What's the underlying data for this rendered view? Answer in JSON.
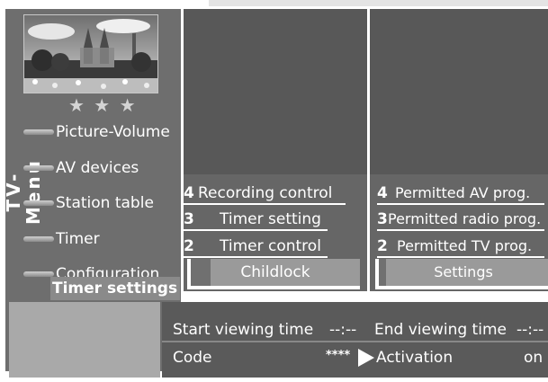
{
  "sidebar": {
    "title": "TV-Menu",
    "stars": "★ ★ ★",
    "items": [
      {
        "label": "Picture-Volume"
      },
      {
        "label": "AV devices"
      },
      {
        "label": "Station table"
      },
      {
        "label": "Timer"
      },
      {
        "label": "Configuration"
      }
    ],
    "selected_label": "Timer settings"
  },
  "middle_panel": {
    "items": [
      {
        "num": "4",
        "label": "Recording control"
      },
      {
        "num": "3",
        "label": "Timer setting"
      },
      {
        "num": "2",
        "label": "Timer control"
      }
    ],
    "selected": "Childlock"
  },
  "right_panel": {
    "items": [
      {
        "num": "4",
        "label": "Permitted AV prog."
      },
      {
        "num": "3",
        "label": "Permitted radio prog."
      },
      {
        "num": "2",
        "label": "Permitted TV prog."
      }
    ],
    "selected": "Settings"
  },
  "info": {
    "start_label": "Start viewing time",
    "start_value": "--:--",
    "end_label": "End viewing time",
    "end_value": "--:--",
    "code_label": "Code",
    "code_value": "****",
    "activation_label": "Activation",
    "activation_value": "on"
  },
  "colors": {
    "panel": "#666666",
    "sidebar": "#6e6e6e",
    "highlight": "#ffffff"
  }
}
